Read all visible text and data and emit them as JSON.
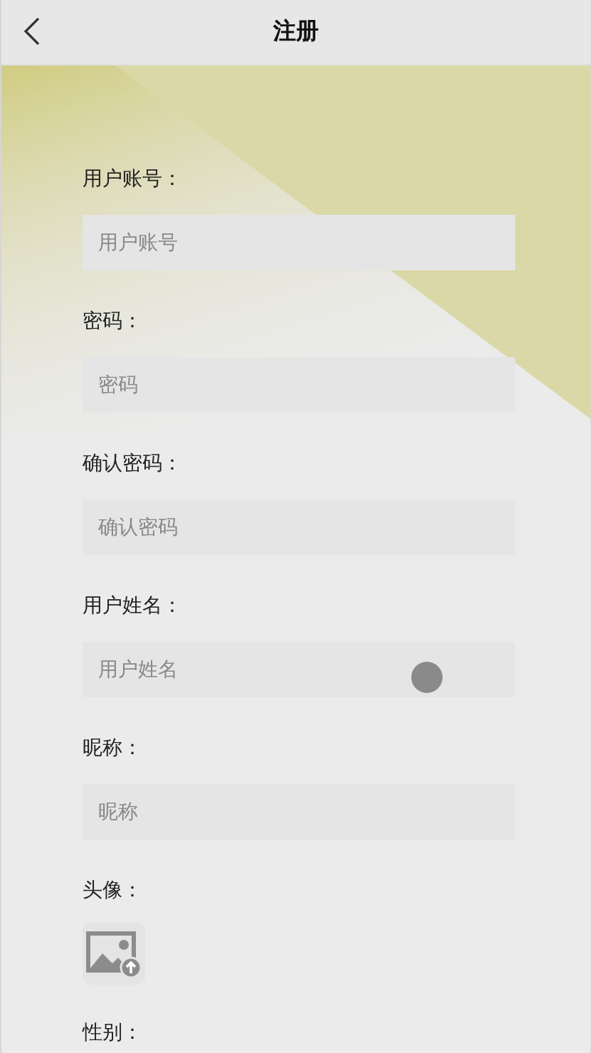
{
  "header": {
    "title": "注册"
  },
  "fields": [
    {
      "kind": "input",
      "label": "用户账号：",
      "placeholder": "用户账号"
    },
    {
      "kind": "input",
      "label": "密码：",
      "placeholder": "密码"
    },
    {
      "kind": "input",
      "label": "确认密码：",
      "placeholder": "确认密码"
    },
    {
      "kind": "input",
      "label": "用户姓名：",
      "placeholder": "用户姓名"
    },
    {
      "kind": "input",
      "label": "昵称：",
      "placeholder": "昵称"
    },
    {
      "kind": "image",
      "label": "头像："
    },
    {
      "kind": "text",
      "label": "性别："
    }
  ]
}
